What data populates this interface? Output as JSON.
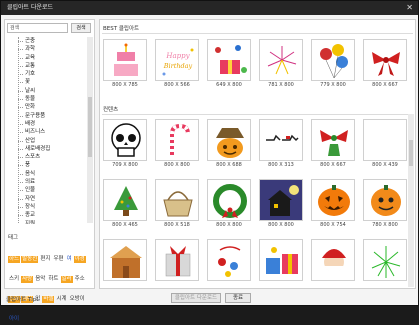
{
  "window": {
    "title": "클립아트 다운로드",
    "close_glyph": "✕"
  },
  "search": {
    "placeholder": "검색",
    "button_label": "검색"
  },
  "tree": [
    "곤충",
    "과학",
    "교육",
    "교통",
    "기호",
    "꽃",
    "날씨",
    "동물",
    "만화",
    "문구용품",
    "배경",
    "비즈니스",
    "산업",
    "새로배경집",
    "스포츠",
    "풍",
    "음식",
    "의료",
    "인물",
    "자연",
    "장식",
    "종교",
    "지원",
    "카드",
    "특별한날"
  ],
  "tree_selected_index": 24,
  "tags": {
    "heading": "태그",
    "items": [
      {
        "label": "하드",
        "style": "hl"
      },
      {
        "label": "발동선",
        "style": "hl"
      },
      {
        "label": "편지",
        "style": "plain"
      },
      {
        "label": "우편",
        "style": "plain"
      },
      {
        "label": "여",
        "style": "blue"
      },
      {
        "label": "야경",
        "style": "hl"
      },
      {
        "label": "스키",
        "style": "plain"
      },
      {
        "label": "사랑",
        "style": "hl"
      },
      {
        "label": "음악",
        "style": "plain"
      },
      {
        "label": "하트",
        "style": "plain"
      },
      {
        "label": "일러",
        "style": "hl"
      },
      {
        "label": "주소",
        "style": "plain"
      },
      {
        "label": "전화",
        "style": "hl"
      },
      {
        "label": "뱀띠",
        "style": "hl"
      },
      {
        "label": "입",
        "style": "plain"
      },
      {
        "label": "바셀",
        "style": "hl"
      },
      {
        "label": "시계",
        "style": "plain"
      },
      {
        "label": "오방이",
        "style": "plain"
      },
      {
        "label": "아이",
        "style": "blue"
      }
    ]
  },
  "best": {
    "title": "BEST 클립아트",
    "items": [
      {
        "icon": "cake",
        "caption": "800 X 785"
      },
      {
        "icon": "happy-birthday",
        "caption": "800 X 566"
      },
      {
        "icon": "gift-box",
        "caption": "649 X 800"
      },
      {
        "icon": "fireworks",
        "caption": "781 X 800"
      },
      {
        "icon": "balloons",
        "caption": "779 X 800"
      },
      {
        "icon": "red-ribbon",
        "caption": "800 X 667"
      }
    ]
  },
  "contents": {
    "title": "컨텐츠",
    "rows": [
      [
        {
          "icon": "skull",
          "caption": "709 X 800"
        },
        {
          "icon": "candy-cane",
          "caption": "800 X 800"
        },
        {
          "icon": "scarecrow-pumpkin",
          "caption": "800 X 688"
        },
        {
          "icon": "santa-sleigh",
          "caption": "800 X 313"
        },
        {
          "icon": "christmas-ribbon",
          "caption": "800 X 667"
        },
        {
          "icon": "blank",
          "caption": "800 X 439"
        }
      ],
      [
        {
          "icon": "christmas-tree",
          "caption": "800 X 465"
        },
        {
          "icon": "basket",
          "caption": "800 X 518"
        },
        {
          "icon": "wreath",
          "caption": "800 X 800"
        },
        {
          "icon": "haunted-house",
          "caption": "800 X 800"
        },
        {
          "icon": "jack-o-lantern",
          "caption": "800 X 754"
        },
        {
          "icon": "pumpkin",
          "caption": "780 X 800"
        }
      ],
      [
        {
          "icon": "gingerbread",
          "caption": ""
        },
        {
          "icon": "present",
          "caption": ""
        },
        {
          "icon": "ornament",
          "caption": ""
        },
        {
          "icon": "presents",
          "caption": ""
        },
        {
          "icon": "santa",
          "caption": ""
        },
        {
          "icon": "green-fireworks",
          "caption": ""
        }
      ]
    ]
  },
  "footer": {
    "tip_label": "클립아트 Tip!",
    "download_label": "클립아트 다운로드",
    "close_label": "종료"
  }
}
